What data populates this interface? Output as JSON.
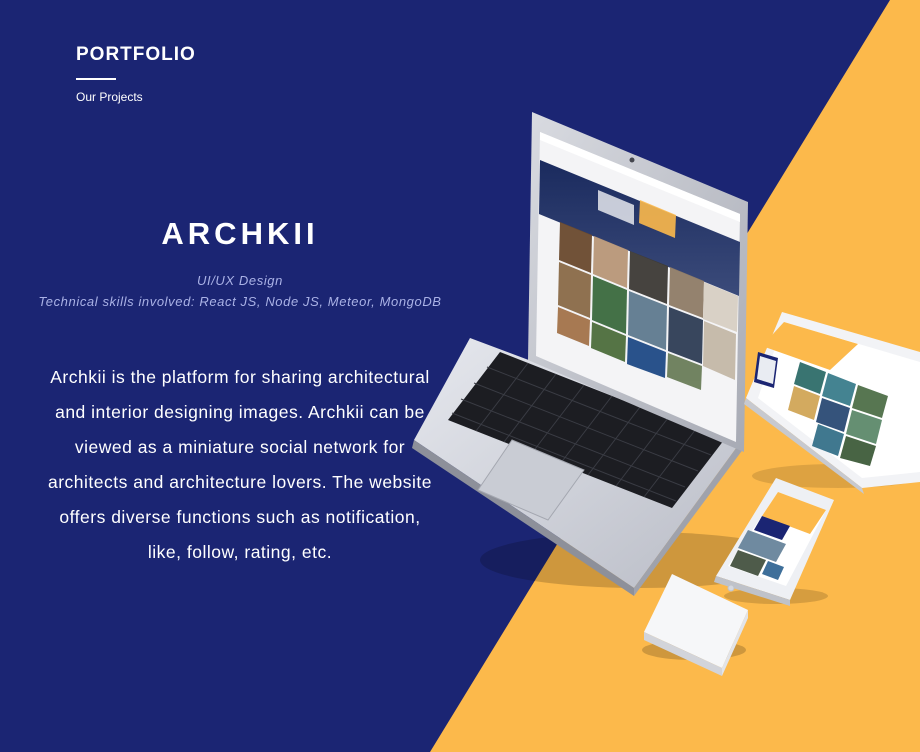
{
  "header": {
    "section_title": "PORTFOLIO",
    "section_subtitle": "Our Projects"
  },
  "project": {
    "name": "ARCHKII",
    "discipline": "UI/UX Design",
    "skills": "Technical skills involved: React JS, Node JS, Meteor, MongoDB",
    "description": "Archkii is the platform for sharing architectural and interior designing images. Archkii can be viewed as a miniature social network for architects and architecture lovers. The website offers diverse functions such as notification, like, follow, rating, etc."
  },
  "colors": {
    "background_navy": "#1b2573",
    "accent_yellow": "#fcb94b",
    "text_white": "#ffffff",
    "meta_text": "#aab2e6"
  },
  "icons": [
    "laptop-mockup",
    "tablet-mockup",
    "phone-mockup",
    "business-card-mockup"
  ]
}
